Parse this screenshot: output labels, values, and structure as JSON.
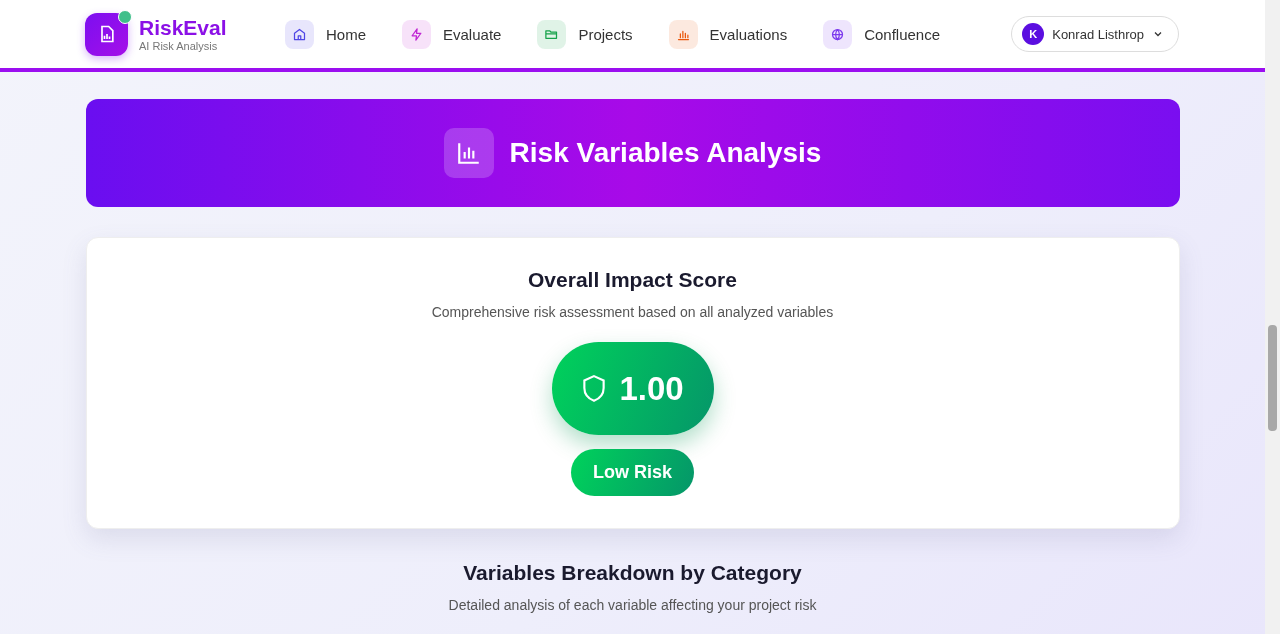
{
  "brand": {
    "name": "RiskEval",
    "tagline": "AI Risk Analysis"
  },
  "nav": [
    {
      "label": "Home",
      "color": "#4f46e5"
    },
    {
      "label": "Evaluate",
      "color": "#c026d3"
    },
    {
      "label": "Projects",
      "color": "#16a34a"
    },
    {
      "label": "Evaluations",
      "color": "#ea580c"
    },
    {
      "label": "Confluence",
      "color": "#7c3aed"
    }
  ],
  "user": {
    "initial": "K",
    "name": "Konrad Listhrop"
  },
  "banner": {
    "title": "Risk Variables Analysis"
  },
  "score_card": {
    "title": "Overall Impact Score",
    "subtitle": "Comprehensive risk assessment based on all analyzed variables",
    "score": "1.00",
    "risk_label": "Low Risk"
  },
  "breakdown": {
    "title": "Variables Breakdown by Category",
    "subtitle": "Detailed analysis of each variable affecting your project risk"
  }
}
